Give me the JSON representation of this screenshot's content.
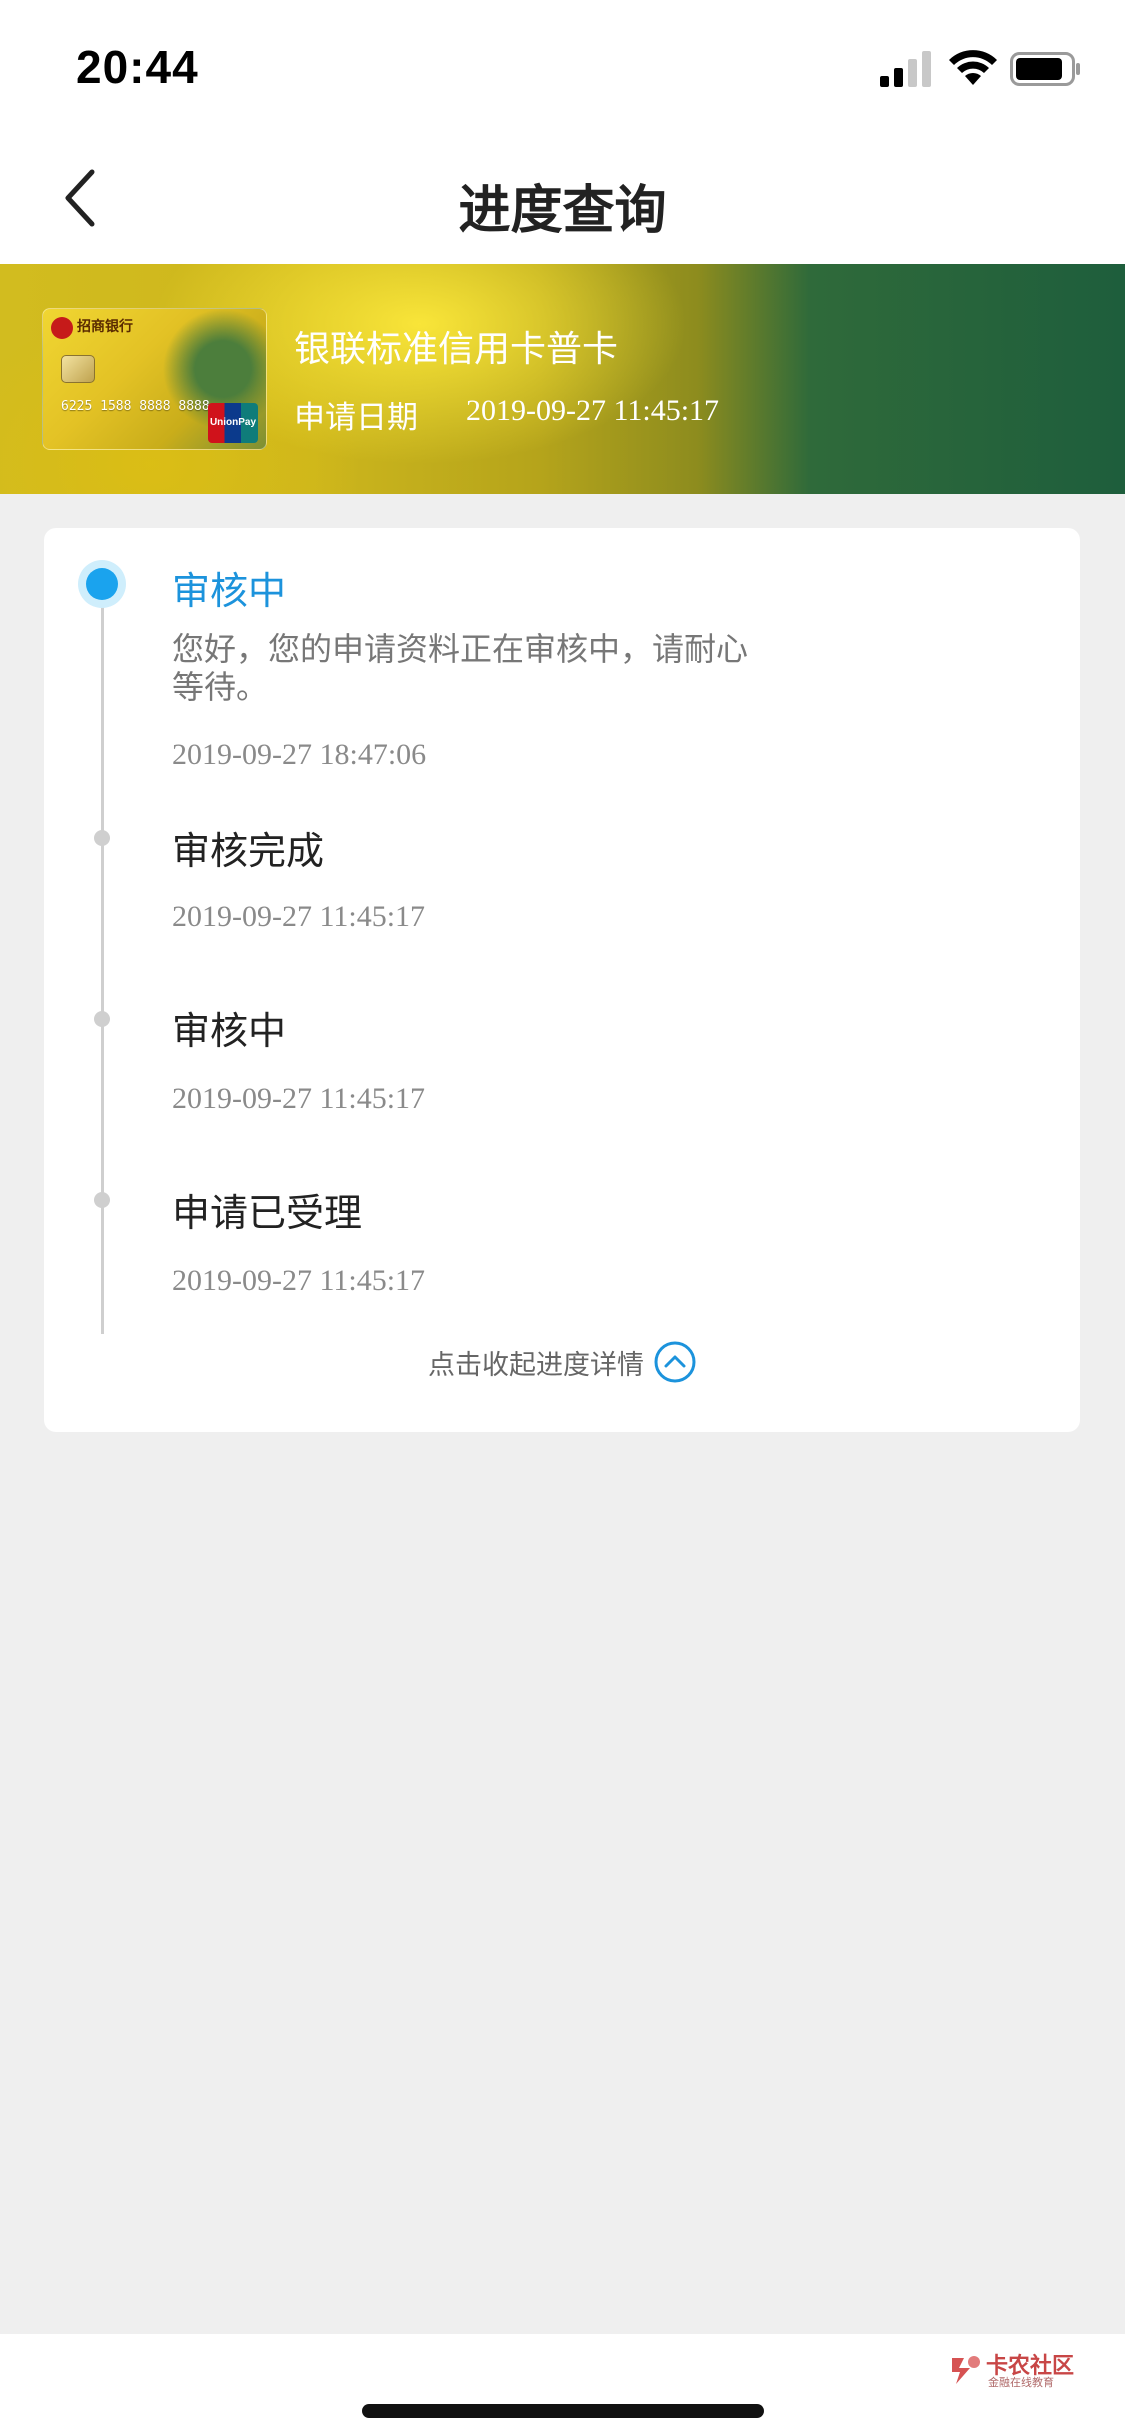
{
  "status_bar": {
    "time": "20:44"
  },
  "nav": {
    "title": "进度查询"
  },
  "card": {
    "name": "银联标准信用卡普卡",
    "apply_date_label": "申请日期",
    "apply_date_value": "2019-09-27 11:45:17",
    "image": {
      "bank": "招商银行",
      "number": "6225 1588 8888 8888",
      "network": "UnionPay"
    }
  },
  "progress": {
    "steps": [
      {
        "title": "审核中",
        "desc": "您好，您的申请资料正在审核中，请耐心等待。",
        "time": "2019-09-27 18:47:06",
        "current": true
      },
      {
        "title": "审核完成",
        "time": "2019-09-27 11:45:17",
        "current": false
      },
      {
        "title": "审核中",
        "time": "2019-09-27 11:45:17",
        "current": false
      },
      {
        "title": "申请已受理",
        "time": "2019-09-27 11:45:17",
        "current": false
      }
    ],
    "collapse_label": "点击收起进度详情"
  },
  "watermark": {
    "name": "卡农社区",
    "sub": "金融在线教育"
  },
  "colors": {
    "accent": "#1c93dc",
    "accent_dot": "#1aa3ee",
    "background": "#efefef"
  }
}
